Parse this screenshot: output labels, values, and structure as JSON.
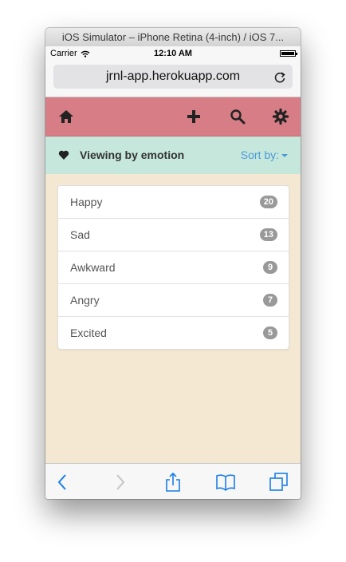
{
  "window": {
    "title": "iOS Simulator – iPhone Retina (4-inch) / iOS 7..."
  },
  "status_bar": {
    "carrier": "Carrier",
    "time": "12:10 AM"
  },
  "address_bar": {
    "url": "jrnl-app.herokuapp.com"
  },
  "navbar": {
    "background": "#d67d85",
    "icons": [
      "home-icon",
      "plus-icon",
      "search-icon",
      "gear-icon"
    ]
  },
  "subheader": {
    "title": "Viewing by emotion",
    "sort_label": "Sort by:",
    "background": "#c6e8dc",
    "accent": "#4a9ad8"
  },
  "emotions": [
    {
      "label": "Happy",
      "count": "20"
    },
    {
      "label": "Sad",
      "count": "13"
    },
    {
      "label": "Awkward",
      "count": "9"
    },
    {
      "label": "Angry",
      "count": "7"
    },
    {
      "label": "Excited",
      "count": "5"
    }
  ],
  "page_background": "#f5e8d3",
  "toolbar": {
    "icons": [
      "back-icon",
      "forward-icon",
      "share-icon",
      "bookmarks-icon",
      "tabs-icon"
    ]
  }
}
